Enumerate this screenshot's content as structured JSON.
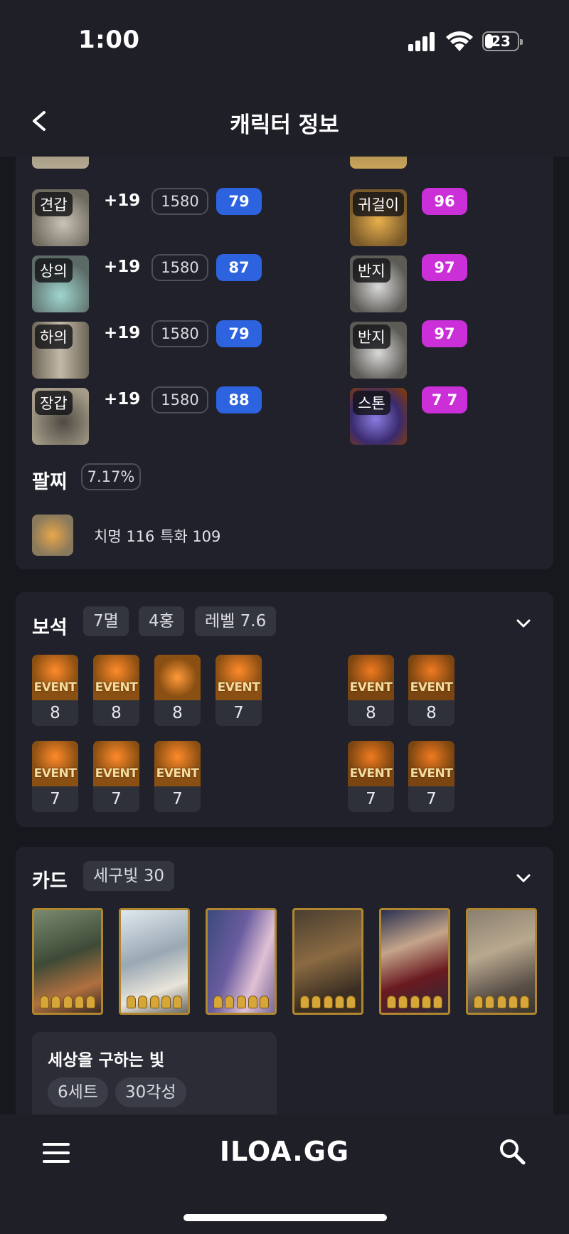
{
  "status_bar": {
    "time": "1:00",
    "battery": "23"
  },
  "header": {
    "title": "캐릭터 정보"
  },
  "equipment": {
    "armor": [
      {
        "label": "견갑",
        "honing": "+19",
        "item_level": "1580",
        "quality": "79"
      },
      {
        "label": "상의",
        "honing": "+19",
        "item_level": "1580",
        "quality": "87"
      },
      {
        "label": "하의",
        "honing": "+19",
        "item_level": "1580",
        "quality": "79"
      },
      {
        "label": "장갑",
        "honing": "+19",
        "item_level": "1580",
        "quality": "88"
      }
    ],
    "accessories": [
      {
        "label": "귀걸이",
        "quality": "96"
      },
      {
        "label": "반지",
        "quality": "97"
      },
      {
        "label": "반지",
        "quality": "97"
      },
      {
        "label": "스톤",
        "quality": "7 7"
      }
    ]
  },
  "bracelet": {
    "title": "팔찌",
    "percent": "7.17%",
    "stats": [
      "치명 116",
      "특화 109"
    ]
  },
  "gems": {
    "title": "보석",
    "tags": [
      "7멸",
      "4홍",
      "레벨 7.6"
    ],
    "event_text": "EVENT",
    "left_row1": [
      {
        "level": "8",
        "event": true
      },
      {
        "level": "8",
        "event": true
      },
      {
        "level": "8",
        "event": false
      },
      {
        "level": "7",
        "event": true
      }
    ],
    "left_row2": [
      {
        "level": "7",
        "event": true
      },
      {
        "level": "7",
        "event": true
      },
      {
        "level": "7",
        "event": true
      }
    ],
    "right_row1": [
      {
        "level": "8",
        "event": true
      },
      {
        "level": "8",
        "event": true
      }
    ],
    "right_row2": [
      {
        "level": "7",
        "event": true
      },
      {
        "level": "7",
        "event": true
      }
    ]
  },
  "cards": {
    "title": "카드",
    "tag": "세구빛 30",
    "set_name": "세상을 구하는 빛",
    "set_tags": [
      "6세트",
      "30각성"
    ]
  },
  "bottom_bar": {
    "logo": "ILOA.GG"
  },
  "colors": {
    "quality_blue": "#2e63e0",
    "quality_purple": "#cb2fd8",
    "card_border": "#b0862f"
  }
}
